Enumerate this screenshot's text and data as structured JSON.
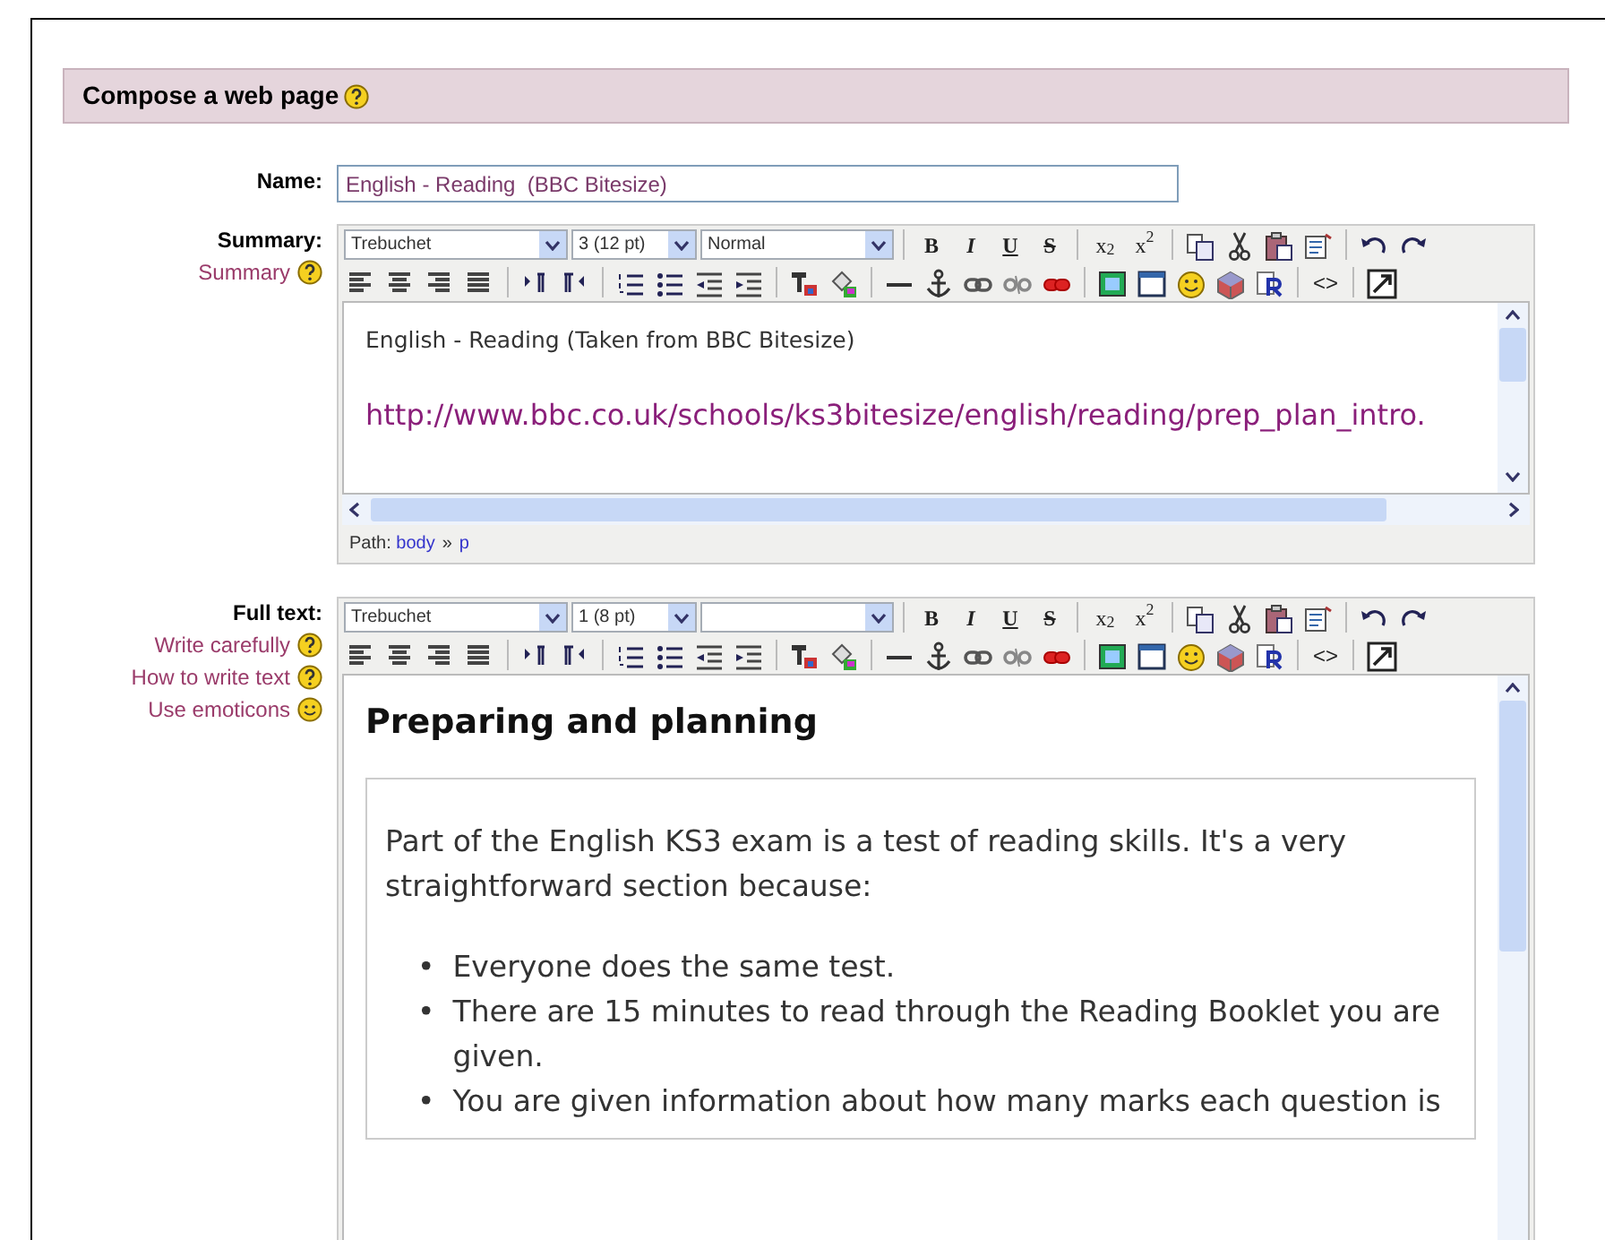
{
  "header": {
    "title": "Compose a web page"
  },
  "name_field": {
    "label": "Name:",
    "value": "English - Reading  (BBC Bitesize)"
  },
  "editors": [
    {
      "label": "Summary:",
      "links": [
        {
          "text": "Summary",
          "kind": "help"
        }
      ],
      "font": "Trebuchet",
      "size": "3 (12 pt)",
      "format": "Normal",
      "toolbar": [
        [
          {
            "kind": "bold",
            "label": "B"
          },
          {
            "kind": "italic",
            "label": "I"
          },
          {
            "kind": "underline",
            "label": "U"
          },
          {
            "kind": "strike",
            "label": "S"
          },
          {
            "kind": "sep"
          },
          {
            "kind": "sub",
            "label": "x$_{2}$"
          },
          {
            "kind": "sup",
            "label": "x$^{2}$"
          },
          {
            "kind": "sep"
          },
          {
            "kind": "copy"
          },
          {
            "kind": "cut"
          },
          {
            "kind": "paste"
          },
          {
            "kind": "pasteword"
          },
          {
            "kind": "sep"
          },
          {
            "kind": "undo"
          },
          {
            "kind": "redo"
          }
        ],
        [
          {
            "kind": "alignleft"
          },
          {
            "kind": "aligncenter"
          },
          {
            "kind": "alignright"
          },
          {
            "kind": "justify"
          },
          {
            "kind": "sep"
          },
          {
            "kind": "ltr"
          },
          {
            "kind": "rtl"
          },
          {
            "kind": "sep"
          },
          {
            "kind": "ol"
          },
          {
            "kind": "ul"
          },
          {
            "kind": "outdent"
          },
          {
            "kind": "indent"
          },
          {
            "kind": "sep"
          },
          {
            "kind": "forecolor"
          },
          {
            "kind": "backcolor"
          },
          {
            "kind": "sep"
          },
          {
            "kind": "hr"
          },
          {
            "kind": "anchor"
          },
          {
            "kind": "link"
          },
          {
            "kind": "unlink"
          },
          {
            "kind": "nolink"
          },
          {
            "kind": "sep"
          },
          {
            "kind": "image"
          },
          {
            "kind": "table"
          },
          {
            "kind": "smiley"
          },
          {
            "kind": "charmap"
          },
          {
            "kind": "replace"
          },
          {
            "kind": "sep"
          },
          {
            "kind": "source",
            "label": "<>"
          },
          {
            "kind": "sep"
          },
          {
            "kind": "fullscreen"
          }
        ]
      ],
      "content": [
        {
          "kind": "para",
          "text": "English - Reading (Taken from BBC Bitesize)"
        },
        {
          "kind": "link",
          "text": "http://www.bbc.co.uk/schools/ks3bitesize/english/reading/prep_plan_intro."
        }
      ],
      "hscroll": true,
      "path": {
        "label": "Path:",
        "items": [
          "body",
          "p"
        ],
        "separator": "»"
      }
    },
    {
      "label": "Full text:",
      "links": [
        {
          "text": "Write carefully",
          "kind": "help"
        },
        {
          "text": "How to write text",
          "kind": "help"
        },
        {
          "text": "Use emoticons",
          "kind": "emoticons"
        }
      ],
      "font": "Trebuchet",
      "size": "1 (8 pt)",
      "toolbar": [
        [
          {
            "kind": "bold",
            "label": "B"
          },
          {
            "kind": "italic",
            "label": "I"
          },
          {
            "kind": "underline",
            "label": "U"
          },
          {
            "kind": "strike",
            "label": "S"
          },
          {
            "kind": "sep"
          },
          {
            "kind": "sub",
            "label": "x$_{2}$"
          },
          {
            "kind": "sup",
            "label": "x$^{2}$"
          },
          {
            "kind": "sep"
          },
          {
            "kind": "copy"
          },
          {
            "kind": "cut"
          },
          {
            "kind": "paste"
          },
          {
            "kind": "pasteword"
          },
          {
            "kind": "sep"
          },
          {
            "kind": "undo"
          },
          {
            "kind": "redo"
          }
        ],
        [
          {
            "kind": "alignleft"
          },
          {
            "kind": "aligncenter"
          },
          {
            "kind": "alignright"
          },
          {
            "kind": "justify"
          },
          {
            "kind": "sep"
          },
          {
            "kind": "ltr"
          },
          {
            "kind": "rtl"
          },
          {
            "kind": "sep"
          },
          {
            "kind": "ol"
          },
          {
            "kind": "ul"
          },
          {
            "kind": "outdent"
          },
          {
            "kind": "indent"
          },
          {
            "kind": "sep"
          },
          {
            "kind": "forecolor"
          },
          {
            "kind": "backcolor"
          },
          {
            "kind": "sep"
          },
          {
            "kind": "hr"
          },
          {
            "kind": "anchor"
          },
          {
            "kind": "link"
          },
          {
            "kind": "unlink"
          },
          {
            "kind": "nolink"
          },
          {
            "kind": "sep"
          },
          {
            "kind": "image"
          },
          {
            "kind": "table"
          },
          {
            "kind": "smiley"
          },
          {
            "kind": "charmap"
          },
          {
            "kind": "replace"
          },
          {
            "kind": "sep"
          },
          {
            "kind": "source",
            "label": "<>"
          },
          {
            "kind": "sep"
          },
          {
            "kind": "fullscreen"
          }
        ]
      ],
      "content": [
        {
          "kind": "heading",
          "text": "Preparing and planning"
        },
        {
          "kind": "box",
          "children": [
            {
              "kind": "para",
              "text": "Part of the English KS3 exam is a test of reading skills. It's a very straightforward section because:"
            },
            {
              "kind": "list",
              "marker": "•",
              "items": [
                "Everyone does the same test.",
                "There are 15 minutes to read through the Reading Booklet you are given.",
                "You are given information about how many marks each question is"
              ]
            }
          ]
        }
      ],
      "hscroll": false
    }
  ]
}
